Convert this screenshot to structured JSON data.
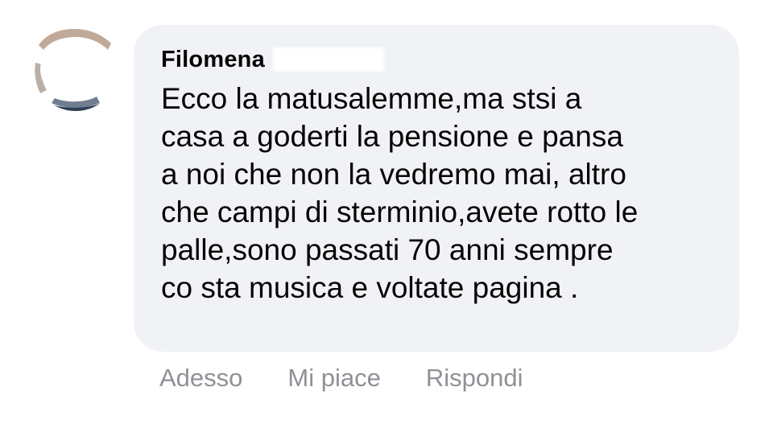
{
  "comment": {
    "author_name": "Filomena",
    "text": "Ecco la matusalemme,ma stsi a\ncasa a goderti la pensione e pansa\na noi che non la vedremo mai,  altro\nche campi di sterminio,avete rotto le\npalle,sono passati 70 anni sempre\nco sta musica e voltate pagina .",
    "avatar_icon": "redacted-profile-avatar",
    "redaction_icon": "redacted-surname-mark"
  },
  "actions": {
    "timestamp": "Adesso",
    "like_label": "Mi piace",
    "reply_label": "Rispondi"
  },
  "colors": {
    "bubble_background": "#f0f2f5",
    "text_primary": "#050505",
    "text_secondary": "#8e9196"
  }
}
